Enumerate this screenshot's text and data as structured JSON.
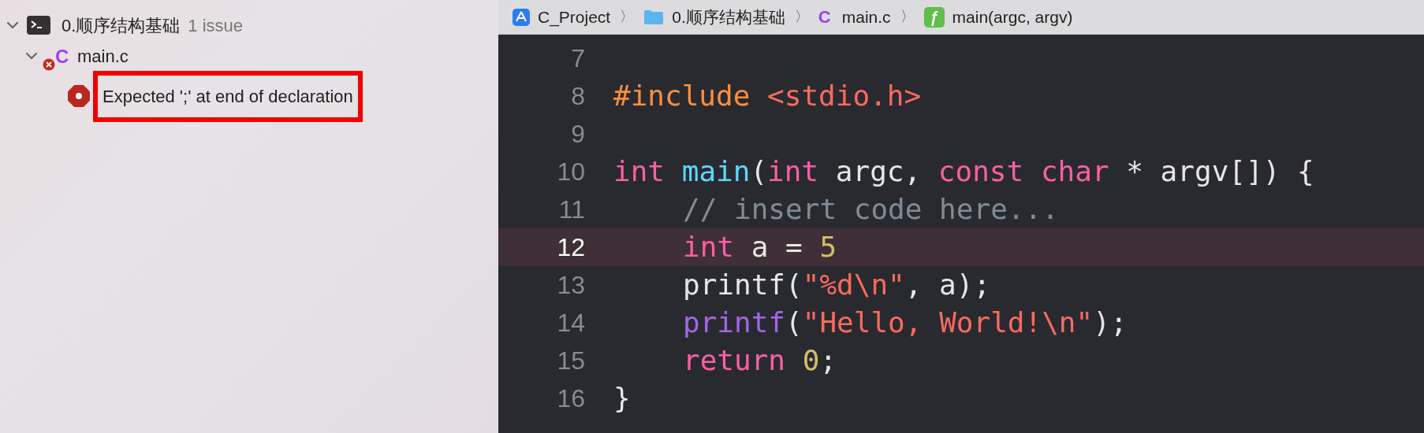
{
  "navigator": {
    "group": {
      "label": "0.顺序结构基础",
      "issue_count": "1 issue",
      "expanded": true,
      "files": [
        {
          "name": "main.c",
          "icon_letter": "C",
          "expanded": true,
          "has_error": true,
          "issues": [
            {
              "message": "Expected ';' at end of declaration",
              "outlined": true
            }
          ]
        }
      ]
    }
  },
  "breadcrumb": [
    {
      "kind": "project",
      "label": "C_Project"
    },
    {
      "kind": "folder",
      "label": "0.顺序结构基础"
    },
    {
      "kind": "cfile",
      "icon_letter": "C",
      "label": "main.c"
    },
    {
      "kind": "function",
      "icon_letter": "ƒ",
      "label": "main(argc, argv)"
    }
  ],
  "separator": "〉",
  "editor": {
    "lines": [
      {
        "number": "7",
        "highlighted": false
      },
      {
        "number": "8",
        "highlighted": false,
        "indented": false,
        "tokens": [
          {
            "kind": "preproc",
            "text": "#include"
          },
          {
            "kind": "string",
            "text": " <stdio.h>"
          }
        ]
      },
      {
        "number": "9",
        "highlighted": false
      },
      {
        "number": "10",
        "highlighted": false,
        "indented": false,
        "tokens": [
          {
            "kind": "keyword",
            "text": "int"
          },
          {
            "kind": "decl",
            "text": " main"
          },
          {
            "kind": "plain",
            "text": "("
          },
          {
            "kind": "keyword",
            "text": "int"
          },
          {
            "kind": "plain",
            "text": " argc, "
          },
          {
            "kind": "keyword",
            "text": "const char"
          },
          {
            "kind": "plain",
            "text": " * argv[]) {"
          }
        ]
      },
      {
        "number": "11",
        "highlighted": false,
        "indented": true,
        "tokens": [
          {
            "kind": "comment",
            "text": "// insert code here..."
          }
        ]
      },
      {
        "number": "12",
        "highlighted": true,
        "indented": true,
        "tokens": [
          {
            "kind": "keyword",
            "text": "int"
          },
          {
            "kind": "plain",
            "text": " a = "
          },
          {
            "kind": "number",
            "text": "5"
          }
        ]
      },
      {
        "number": "13",
        "highlighted": false,
        "indented": true,
        "tokens": [
          {
            "kind": "plain",
            "text": "printf("
          },
          {
            "kind": "string",
            "text": "\"%d\\n\""
          },
          {
            "kind": "plain",
            "text": ", a);"
          }
        ]
      },
      {
        "number": "14",
        "highlighted": false,
        "indented": true,
        "tokens": [
          {
            "kind": "func",
            "text": "printf"
          },
          {
            "kind": "plain",
            "text": "("
          },
          {
            "kind": "string",
            "text": "\"Hello, World!\\n\""
          },
          {
            "kind": "plain",
            "text": ");"
          }
        ]
      },
      {
        "number": "15",
        "highlighted": false,
        "indented": true,
        "tokens": [
          {
            "kind": "keyword",
            "text": "return"
          },
          {
            "kind": "number",
            "text": " 0"
          },
          {
            "kind": "plain",
            "text": ";"
          }
        ]
      },
      {
        "number": "16",
        "highlighted": false,
        "indented": false,
        "tokens": [
          {
            "kind": "plain",
            "text": "}"
          }
        ]
      }
    ]
  }
}
